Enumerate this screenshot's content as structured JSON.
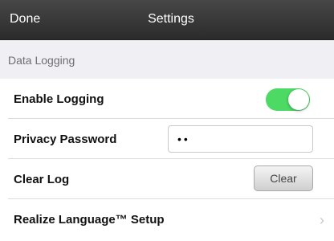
{
  "navbar": {
    "done_label": "Done",
    "title": "Settings"
  },
  "section": {
    "header": "Data Logging"
  },
  "rows": [
    {
      "label": "Enable Logging",
      "control": "toggle",
      "toggle_on": true,
      "toggle_color": "#4cd964"
    },
    {
      "label": "Privacy Password",
      "control": "password-field",
      "value": "••"
    },
    {
      "label": "Clear Log",
      "control": "button",
      "button_label": "Clear"
    },
    {
      "label": "Realize Language™ Setup",
      "control": "disclosure",
      "chevron": "›"
    }
  ]
}
